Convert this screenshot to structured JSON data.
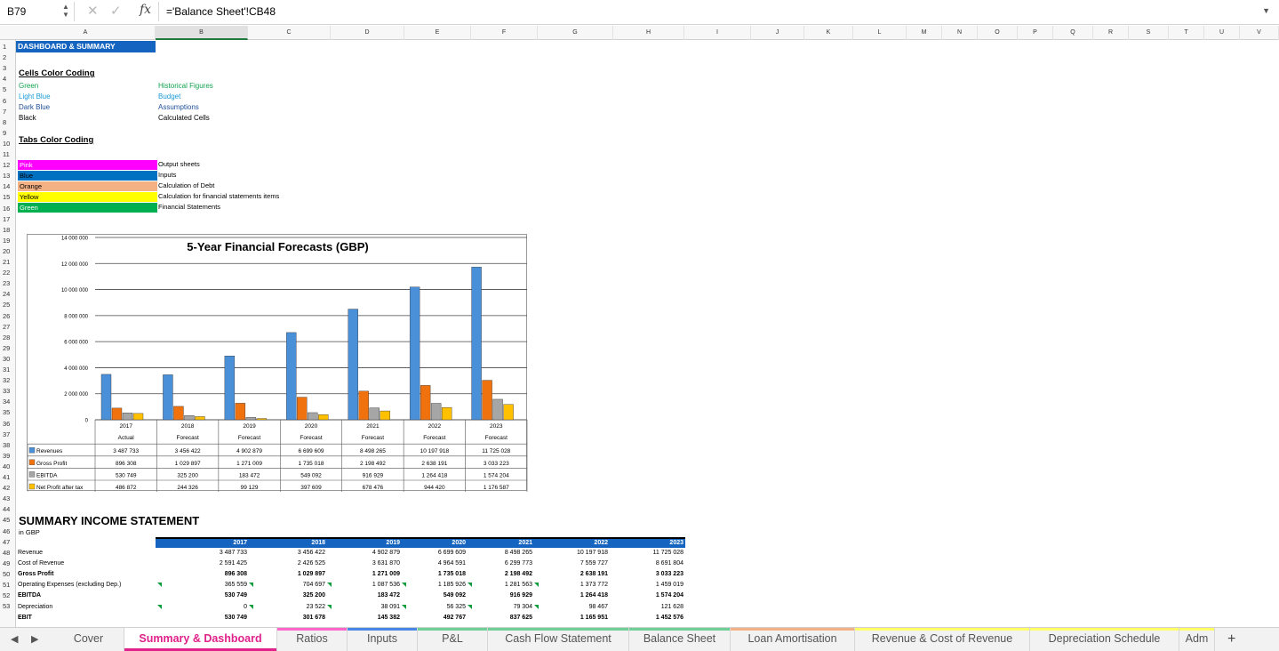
{
  "formula_bar": {
    "cell_ref": "B79",
    "cancel_icon": "✕",
    "confirm_icon": "✓",
    "fx_label": "fx",
    "formula": "='Balance Sheet'!CB48"
  },
  "columns": [
    "A",
    "B",
    "C",
    "D",
    "E",
    "F",
    "G",
    "H",
    "I",
    "J",
    "K",
    "L",
    "M",
    "N",
    "O",
    "P",
    "Q",
    "R",
    "S",
    "T",
    "U",
    "V"
  ],
  "rows": [
    "1",
    "2",
    "3",
    "4",
    "5",
    "6",
    "7",
    "8",
    "9",
    "10",
    "11",
    "12",
    "13",
    "14",
    "15",
    "16",
    "17",
    "18",
    "19",
    "20",
    "21",
    "22",
    "23",
    "24",
    "25",
    "26",
    "27",
    "28",
    "29",
    "30",
    "31",
    "32",
    "33",
    "34",
    "35",
    "36",
    "37",
    "38",
    "39",
    "40",
    "41",
    "42",
    "43",
    "44",
    "45",
    "46",
    "47",
    "48",
    "49",
    "50",
    "51",
    "52",
    "53"
  ],
  "sheet": {
    "title": "DASHBOARD & SUMMARY",
    "cells_color_coding": {
      "heading": "Cells Color Coding",
      "items": [
        {
          "color": "Green",
          "meaning": "Historical Figures"
        },
        {
          "color": "Light Blue",
          "meaning": "Budget"
        },
        {
          "color": "Dark Blue",
          "meaning": "Assumptions"
        },
        {
          "color": "Black",
          "meaning": "Calculated Cells"
        }
      ]
    },
    "tabs_color_coding": {
      "heading": "Tabs Color Coding",
      "items": [
        {
          "label": "Pink",
          "meaning": "Output sheets",
          "hex": "#ff00ff"
        },
        {
          "label": "Blue",
          "meaning": "Inputs",
          "hex": "#0070c0"
        },
        {
          "label": "Orange",
          "meaning": "Calculation of Debt",
          "hex": "#f4b183"
        },
        {
          "label": "Yellow",
          "meaning": "Calculation for financial statements items",
          "hex": "#ffff00"
        },
        {
          "label": "Green",
          "meaning": "Financial Statements",
          "hex": "#00b050"
        }
      ]
    }
  },
  "chart_data": {
    "type": "bar",
    "title": "5-Year Financial Forecasts (GBP)",
    "categories": [
      "2017",
      "2018",
      "2019",
      "2020",
      "2021",
      "2022",
      "2023"
    ],
    "category_sublabels": [
      "Actual",
      "Forecast",
      "Forecast",
      "Forecast",
      "Forecast",
      "Forecast",
      "Forecast"
    ],
    "ylim": [
      0,
      14000000
    ],
    "yticks": [
      "0",
      "2 000 000",
      "4 000 000",
      "6 000 000",
      "8 000 000",
      "10 000 000",
      "12 000 000",
      "14 000 000"
    ],
    "grid": true,
    "legend": "data-table-bottom",
    "series": [
      {
        "name": "Revenues",
        "color": "#4a90d9",
        "values": [
          3487733,
          3456422,
          4902879,
          6699609,
          8498265,
          10197918,
          11725028
        ],
        "labels": [
          "3 487 733",
          "3 456 422",
          "4 902 879",
          "6 699 609",
          "8 498 265",
          "10 197 918",
          "11 725 028"
        ]
      },
      {
        "name": "Gross Profit",
        "color": "#f0720f",
        "values": [
          896308,
          1029897,
          1271009,
          1735018,
          2198492,
          2638191,
          3033223
        ],
        "labels": [
          "896 308",
          "1 029 897",
          "1 271 009",
          "1 735 018",
          "2 198 492",
          "2 638 191",
          "3 033 223"
        ]
      },
      {
        "name": "EBITDA",
        "color": "#a6a6a6",
        "values": [
          530749,
          325200,
          183472,
          549092,
          916929,
          1264418,
          1574204
        ],
        "labels": [
          "530 749",
          "325 200",
          "183 472",
          "549 092",
          "916 929",
          "1 264 418",
          "1 574 204"
        ]
      },
      {
        "name": "Net Profit after tax",
        "color": "#ffc000",
        "values": [
          486872,
          244326,
          99129,
          397609,
          678476,
          944420,
          1176587
        ],
        "labels": [
          "486 872",
          "244 326",
          "99 129",
          "397 609",
          "678 476",
          "944 420",
          "1 176 587"
        ]
      }
    ]
  },
  "summary": {
    "title": "SUMMARY INCOME STATEMENT",
    "unit": "in GBP",
    "years": [
      "2017",
      "2018",
      "2019",
      "2020",
      "2021",
      "2022",
      "2023"
    ],
    "rows": [
      {
        "label": "Revenue",
        "bold": false,
        "values": [
          "3 487 733",
          "3 456 422",
          "4 902 879",
          "6 699 609",
          "8 498 265",
          "10 197 918",
          "11 725 028"
        ]
      },
      {
        "label": "Cost of Revenue",
        "bold": false,
        "values": [
          "2 591 425",
          "2 426 525",
          "3 631 870",
          "4 964 591",
          "6 299 773",
          "7 559 727",
          "8 691 804"
        ]
      },
      {
        "label": "Gross Profit",
        "bold": true,
        "values": [
          "896 308",
          "1 029 897",
          "1 271 009",
          "1 735 018",
          "2 198 492",
          "2 638 191",
          "3 033 223"
        ]
      },
      {
        "label": "Operating Expenses (excluding Dep.)",
        "bold": false,
        "values": [
          "365 559",
          "704 697",
          "1 087 536",
          "1 185 926",
          "1 281 563",
          "1 373 772",
          "1 459 019"
        ]
      },
      {
        "label": "EBITDA",
        "bold": true,
        "values": [
          "530 749",
          "325 200",
          "183 472",
          "549 092",
          "916 929",
          "1 264 418",
          "1 574 204"
        ]
      },
      {
        "label": "Depreciation",
        "bold": false,
        "values": [
          "0",
          "23 522",
          "38 091",
          "56 325",
          "79 304",
          "98 467",
          "121 628"
        ]
      },
      {
        "label": "EBIT",
        "bold": true,
        "values": [
          "530 749",
          "301 678",
          "145 382",
          "492 767",
          "837 625",
          "1 165 951",
          "1 452 576"
        ]
      }
    ]
  },
  "tabs": [
    {
      "label": "Cover",
      "color": "",
      "active": false
    },
    {
      "label": "Summary & Dashboard",
      "color": "#ff66cc",
      "active": true
    },
    {
      "label": "Ratios",
      "color": "#ff66cc",
      "active": false
    },
    {
      "label": "Inputs",
      "color": "#4a86e8",
      "active": false
    },
    {
      "label": "P&L",
      "color": "#6fcf97",
      "active": false
    },
    {
      "label": "Cash Flow Statement",
      "color": "#6fcf97",
      "active": false
    },
    {
      "label": "Balance Sheet",
      "color": "#6fcf97",
      "active": false
    },
    {
      "label": "Loan Amortisation",
      "color": "#f4b183",
      "active": false
    },
    {
      "label": "Revenue & Cost of Revenue",
      "color": "#ffff66",
      "active": false
    },
    {
      "label": "Depreciation Schedule",
      "color": "#ffff66",
      "active": false
    },
    {
      "label": "Adm",
      "color": "#ffff66",
      "active": false
    }
  ],
  "tab_nav": {
    "prev": "◀",
    "next": "▶",
    "add": "+"
  }
}
